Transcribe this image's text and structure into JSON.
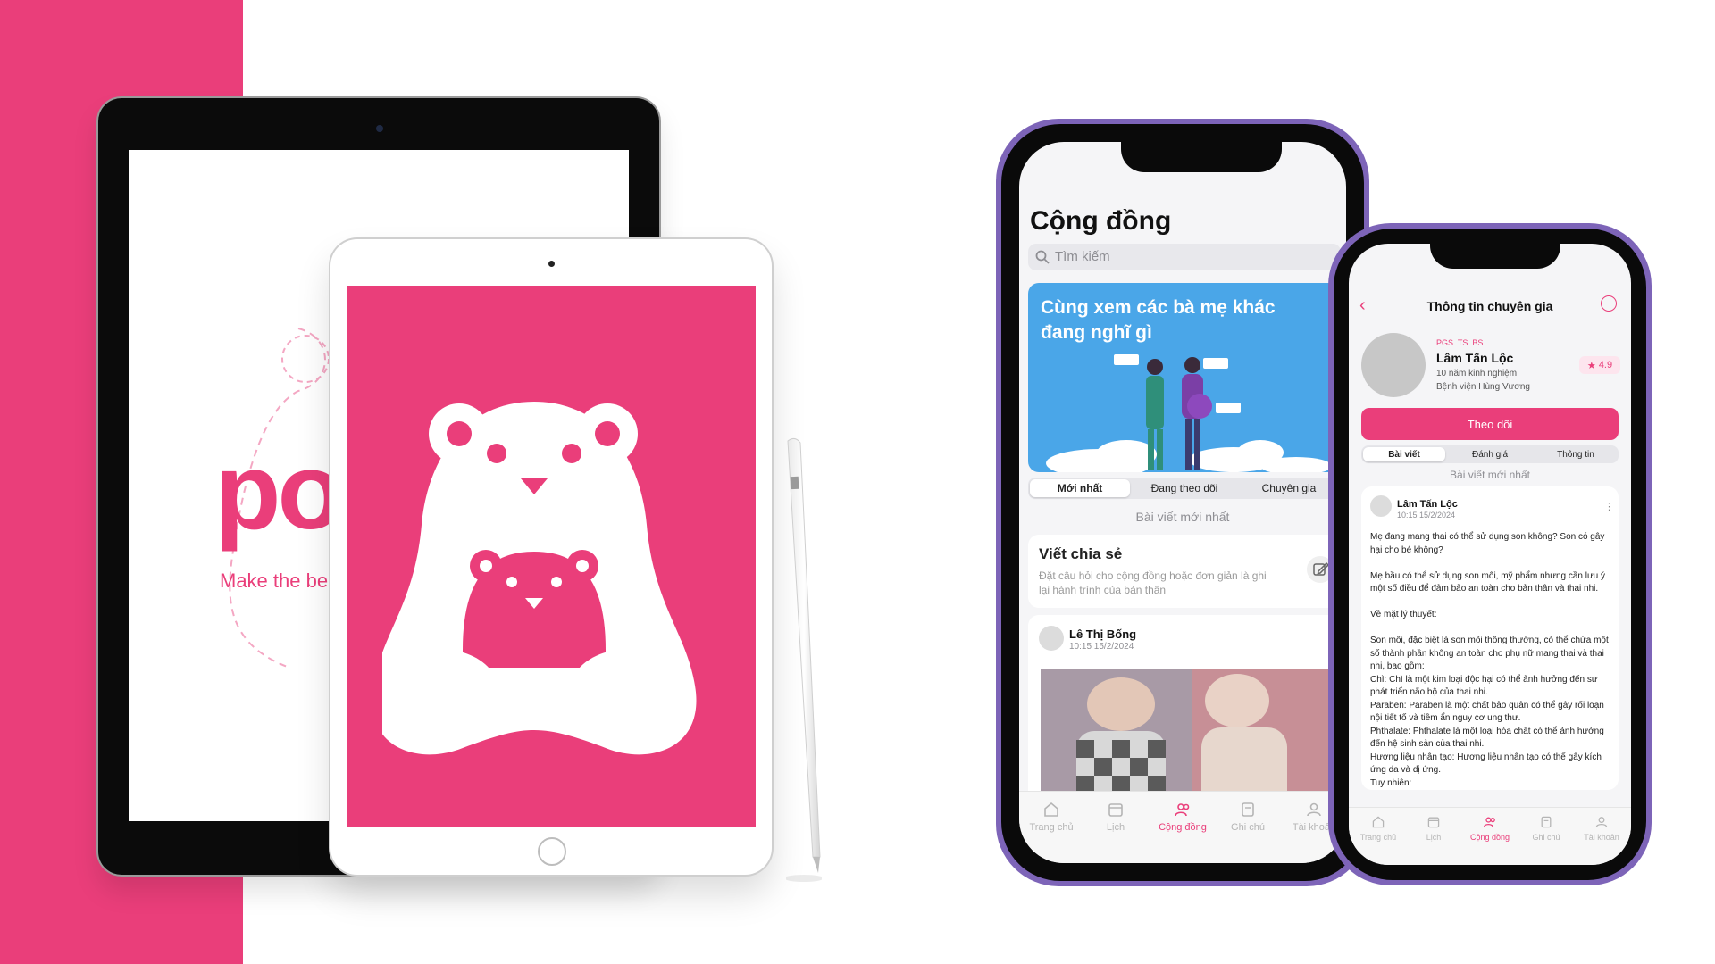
{
  "colors": {
    "brand_pink": "#ea3e7a",
    "phone_frame": "#7d64b8",
    "banner_blue": "#4aa6e8"
  },
  "ipad_back": {
    "logo_text": "po",
    "tagline": "Make the be"
  },
  "phone_community": {
    "title": "Cộng đồng",
    "search_placeholder": "Tìm kiếm",
    "banner_text": "Cùng xem các bà mẹ khác đang nghĩ gì",
    "tabs": [
      {
        "label": "Mới nhất",
        "active": true
      },
      {
        "label": "Đang theo dõi",
        "active": false
      },
      {
        "label": "Chuyên gia",
        "active": false
      }
    ],
    "section_title": "Bài viết mới nhất",
    "share_card": {
      "title": "Viết chia sẻ",
      "description": "Đặt câu hỏi cho cộng đồng hoặc đơn giản là ghi lại hành trình của bản thân"
    },
    "post": {
      "author": "Lê Thị Bống",
      "time": "10:15 15/2/2024"
    },
    "nav": [
      {
        "label": "Trang chủ",
        "icon": "home-icon"
      },
      {
        "label": "Lịch",
        "icon": "calendar-icon"
      },
      {
        "label": "Cộng đồng",
        "icon": "community-icon",
        "active": true
      },
      {
        "label": "Ghi chú",
        "icon": "note-icon"
      },
      {
        "label": "Tài khoản",
        "icon": "user-icon"
      }
    ]
  },
  "phone_expert": {
    "title": "Thông tin chuyên gia",
    "degree": "PGS. TS. BS",
    "name": "Lâm Tấn Lộc",
    "experience": "10 năm kinh nghiệm",
    "hospital": "Bệnh viện Hùng Vương",
    "rating": "4.9",
    "follow_label": "Theo dõi",
    "tabs": [
      {
        "label": "Bài viết",
        "active": true
      },
      {
        "label": "Đánh giá",
        "active": false
      },
      {
        "label": "Thông tin",
        "active": false
      }
    ],
    "section_title": "Bài viết mới nhất",
    "post": {
      "author": "Lâm Tấn Lộc",
      "time": "10:15 15/2/2024",
      "body": "Mẹ đang mang thai có thể sử dụng son không? Son có gây hại cho bé không?\n\nMẹ bầu có thể sử dụng son môi, mỹ phẩm nhưng cần lưu ý một số điều để đảm bảo an toàn cho bản thân và thai nhi.\n\nVề mặt lý thuyết:\n\nSon môi, đặc biệt là son môi thông thường, có thể chứa một số thành phần không an toàn cho phụ nữ mang thai và thai nhi, bao gồm:\nChì: Chì là một kim loại độc hại có thể ảnh hưởng đến sự phát triển não bộ của thai nhi.\nParaben: Paraben là một chất bảo quản có thể gây rối loạn nội tiết tố và tiềm ẩn nguy cơ ung thư.\nPhthalate: Phthalate là một loại hóa chất có thể ảnh hưởng đến hệ sinh sản của thai nhi.\nHương liệu nhân tạo: Hương liệu nhân tạo có thể gây kích ứng da và dị ứng.\nTuy nhiên:"
    },
    "nav": [
      {
        "label": "Trang chủ"
      },
      {
        "label": "Lịch"
      },
      {
        "label": "Cộng đồng",
        "active": true
      },
      {
        "label": "Ghi chú"
      },
      {
        "label": "Tài khoản"
      }
    ]
  }
}
